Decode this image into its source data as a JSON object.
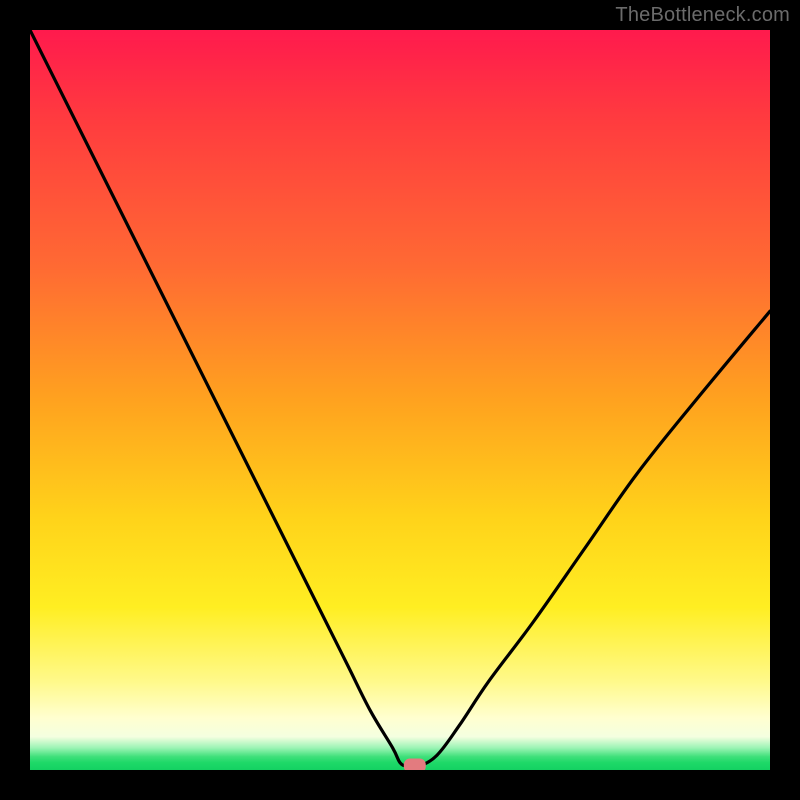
{
  "watermark": {
    "text": "TheBottleneck.com"
  },
  "chart_data": {
    "type": "line",
    "title": "",
    "xlabel": "",
    "ylabel": "",
    "xlim": [
      0,
      100
    ],
    "ylim": [
      0,
      100
    ],
    "grid": false,
    "legend": false,
    "series": [
      {
        "name": "bottleneck-curve",
        "x": [
          0,
          5,
          10,
          15,
          20,
          25,
          30,
          35,
          40,
          43,
          46,
          49,
          50,
          51,
          52.5,
          55,
          58,
          62,
          68,
          75,
          82,
          90,
          100
        ],
        "values": [
          100,
          90,
          80,
          70,
          60,
          50,
          40,
          30,
          20,
          14,
          8,
          3,
          1,
          0.5,
          0.5,
          2,
          6,
          12,
          20,
          30,
          40,
          50,
          62
        ]
      }
    ],
    "marker": {
      "x": 52,
      "y": 0.6,
      "color": "#e37b7f",
      "shape": "rounded-rect"
    },
    "background_gradient": {
      "direction": "vertical",
      "stops": [
        {
          "pos": 0.0,
          "color": "#ff1a4d"
        },
        {
          "pos": 0.32,
          "color": "#ff6a33"
        },
        {
          "pos": 0.66,
          "color": "#ffd31a"
        },
        {
          "pos": 0.93,
          "color": "#ffffd0"
        },
        {
          "pos": 0.98,
          "color": "#3fe07a"
        },
        {
          "pos": 1.0,
          "color": "#14d162"
        }
      ]
    }
  }
}
